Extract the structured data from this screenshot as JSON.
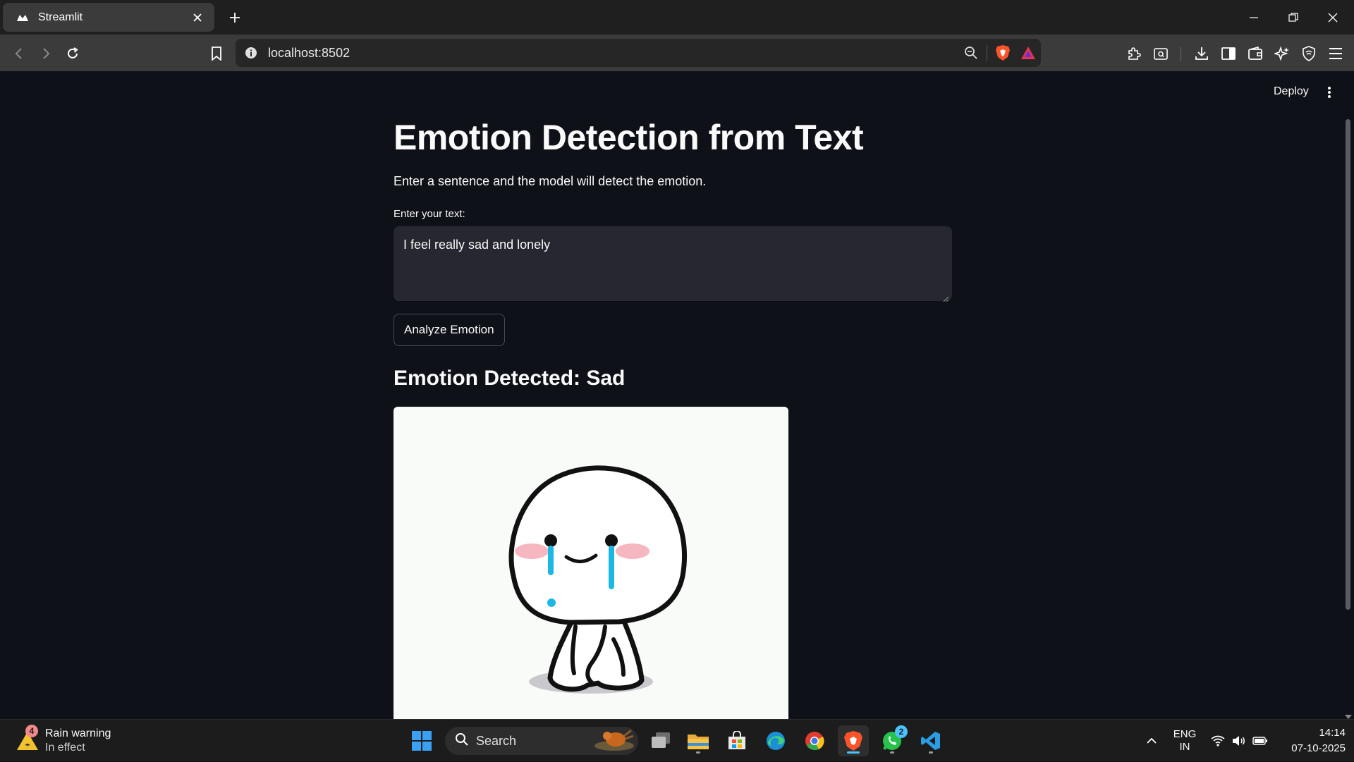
{
  "browser": {
    "tab_title": "Streamlit",
    "url": "localhost:8502"
  },
  "app": {
    "deploy_label": "Deploy",
    "title": "Emotion Detection from Text",
    "subtitle": "Enter a sentence and the model will detect the emotion.",
    "input_label": "Enter your text:",
    "input_value": "I feel really sad and lonely",
    "button_label": "Analyze Emotion",
    "result": "Emotion Detected: Sad",
    "image_icon": "sad-crying-cartoon-icon"
  },
  "taskbar": {
    "weather_badge": "4",
    "weather_title": "Rain warning",
    "weather_sub": "In effect",
    "search_label": "Search",
    "whatsapp_badge": "2",
    "language": "ENG",
    "region": "IN",
    "time": "14:14",
    "date": "07-10-2025"
  },
  "colors": {
    "page_bg": "#0e1117",
    "input_bg": "#262730",
    "tear": "#1bb8e6",
    "blush": "#f6b7c1"
  }
}
